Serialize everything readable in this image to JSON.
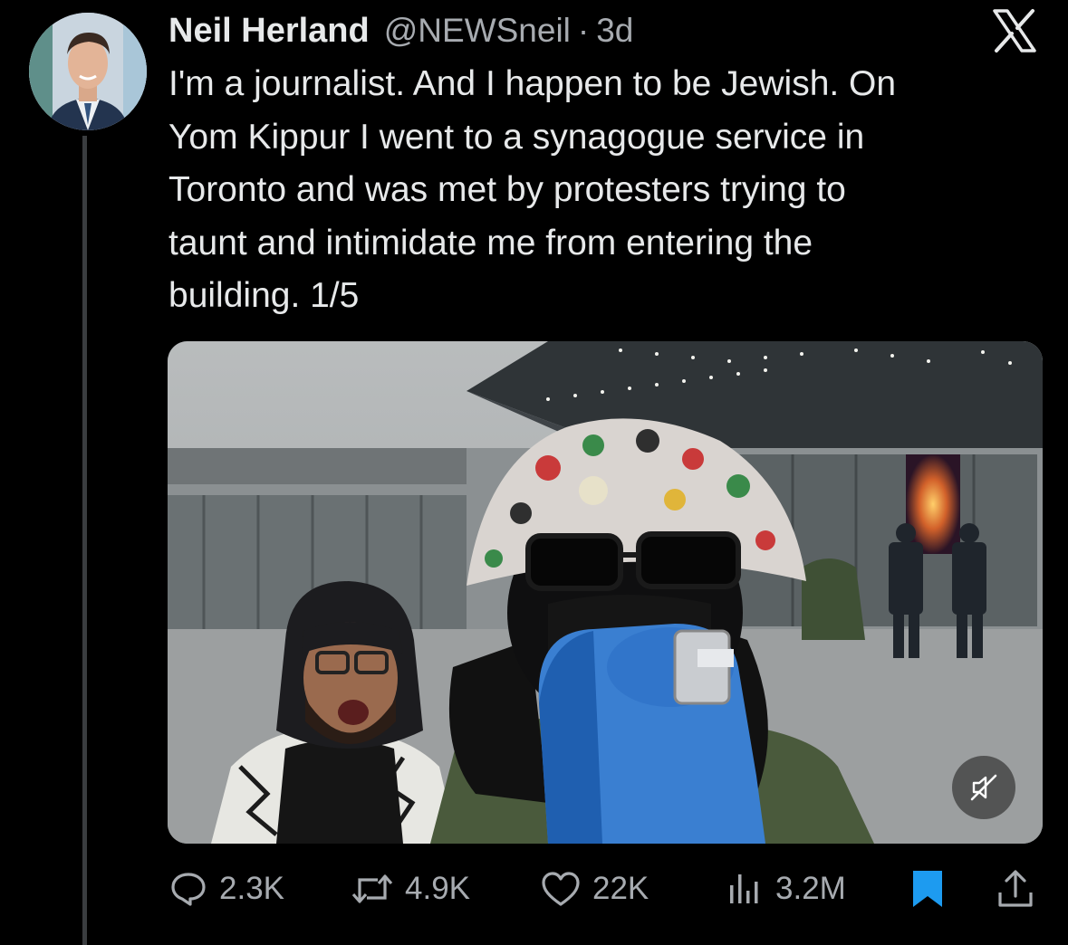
{
  "author": {
    "name": "Neil Herland",
    "handle": "@NEWSneil",
    "separator": "·",
    "time": "3d"
  },
  "tweet": {
    "text": "I'm a journalist. And I happen to be Jewish. On\nYom Kippur I went to a synagogue service in\nToronto and was met by protesters trying to\ntaunt and intimidate me from entering the\nbuilding. 1/5"
  },
  "icons": {
    "platform": "x-logo-icon",
    "mute": "muted-speaker-icon",
    "reply": "reply-bubble-icon",
    "retweet": "retweet-arrows-icon",
    "like": "heart-icon",
    "views": "bar-chart-icon",
    "bookmark": "bookmark-icon",
    "share": "share-upload-icon"
  },
  "metrics": {
    "replies": "2.3K",
    "retweets": "4.9K",
    "likes": "22K",
    "views": "3.2M"
  },
  "colors": {
    "background": "#000000",
    "text": "#e7e9ea",
    "muted_text": "#a7abb0",
    "bookmark_active": "#1d9bf0"
  }
}
